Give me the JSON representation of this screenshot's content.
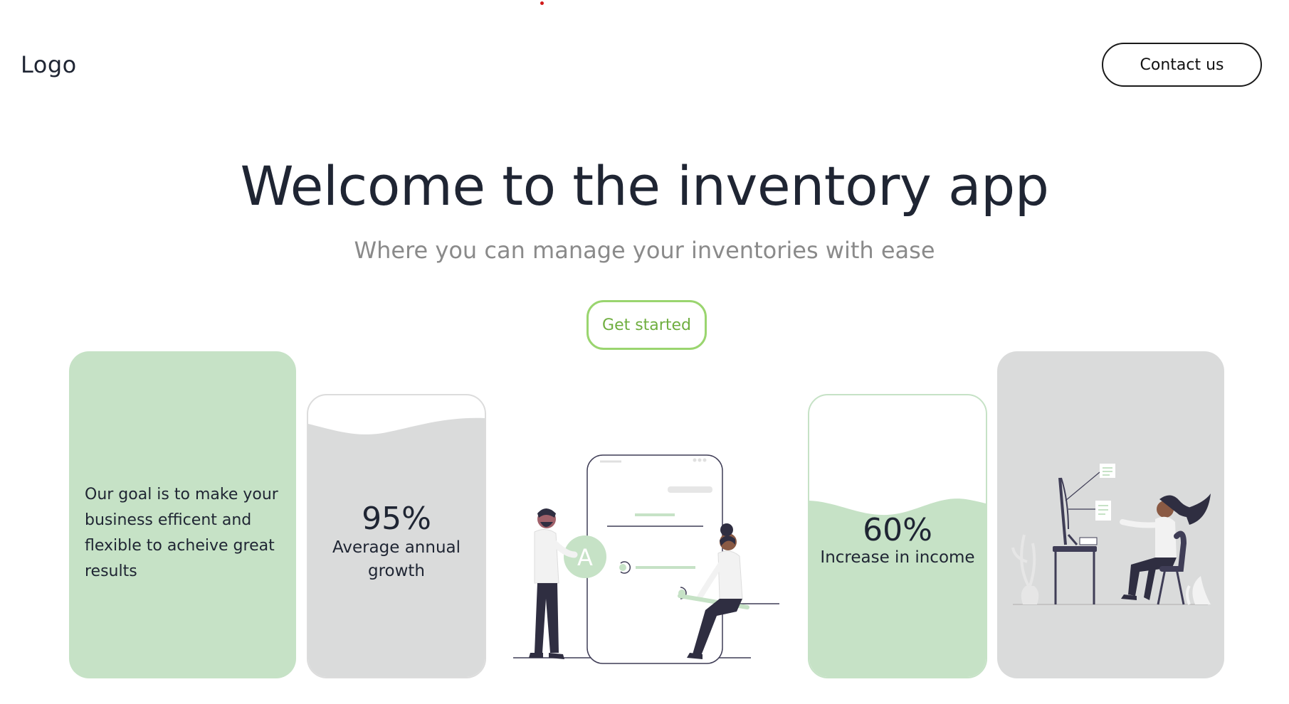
{
  "header": {
    "logo": "Logo",
    "contact_label": "Contact us"
  },
  "hero": {
    "title": "Welcome to the inventory app",
    "subtitle": "Where you can manage your inventories with ease",
    "cta_label": "Get started"
  },
  "cards": {
    "goal_text": "Our goal is to make your business efficent and flexible to acheive great results",
    "growth": {
      "value": "95%",
      "label": "Average annual growth"
    },
    "income": {
      "value": "60%",
      "label": "Increase in income"
    }
  },
  "colors": {
    "dark_text": "#1f2533",
    "muted_text": "#8a8a8a",
    "accent_green": "#9ad56f",
    "accent_green_text": "#6fae3f",
    "card_green": "#c6e2c6",
    "card_gray": "#dadbdb"
  },
  "illustrations": {
    "center": "people-with-phone-illustration",
    "right": "woman-at-desk-illustration"
  }
}
